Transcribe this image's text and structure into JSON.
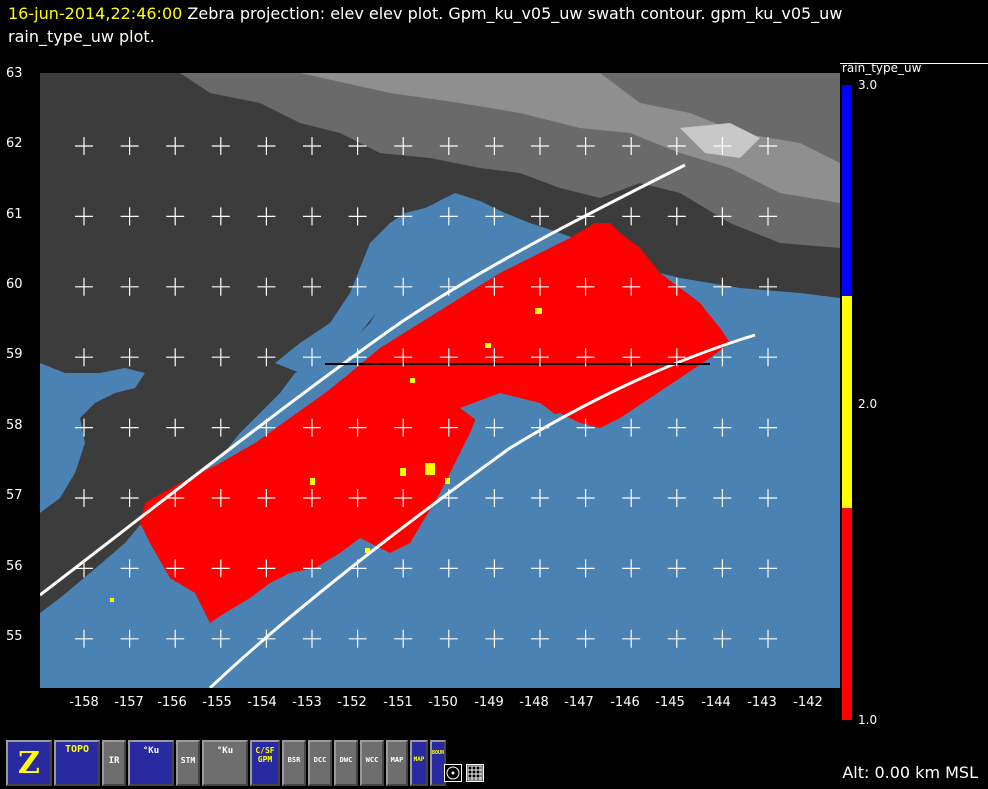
{
  "title": {
    "timestamp": "16-jun-2014,22:46:00",
    "line1_rest": "  Zebra projection: elev elev  plot.  Gpm_ku_v05_uw swath contour.  gpm_ku_v05_uw",
    "line2": "rain_type_uw  plot."
  },
  "map": {
    "lat_labels": [
      "63",
      "62",
      "61",
      "60",
      "59",
      "58",
      "57",
      "56",
      "55"
    ],
    "lon_labels": [
      "-158",
      "-157",
      "-156",
      "-155",
      "-154",
      "-153",
      "-152",
      "-151",
      "-150",
      "-149",
      "-148",
      "-147",
      "-146",
      "-145",
      "-144",
      "-143",
      "-142"
    ],
    "colors": {
      "ocean": "#4a82b4",
      "land_dark": "#3c3c3c",
      "rain_stratiform": "#ff0000",
      "rain_convective": "#ffff00",
      "swath_edge": "#ffffff"
    }
  },
  "colorbar": {
    "label": "rain_type_uw",
    "ticks": [
      "3.0",
      "2.0",
      "1.0"
    ],
    "colors": [
      "#0000ff",
      "#ffff00",
      "#ff0000"
    ]
  },
  "toolbar": {
    "buttons": [
      {
        "name": "zebra-logo-button",
        "label": "Z"
      },
      {
        "name": "topo-button",
        "label": "TOPO"
      },
      {
        "name": "ir-button",
        "label": "IR"
      },
      {
        "name": "ku-button",
        "label": "°Ku"
      },
      {
        "name": "stm-button",
        "label": "STM"
      },
      {
        "name": "ku-ws-button",
        "label": "°Ku"
      },
      {
        "name": "c-sf-gpm-button",
        "label": "C/SF GPM"
      },
      {
        "name": "bsr-button",
        "label": "BSR"
      },
      {
        "name": "dcc-button",
        "label": "DCC"
      },
      {
        "name": "dwc-button",
        "label": "DWC"
      },
      {
        "name": "wcc-button",
        "label": "WCC"
      },
      {
        "name": "map-button",
        "label": "MAP"
      },
      {
        "name": "map-us-button",
        "label": "MAP"
      },
      {
        "name": "bounds-button",
        "label": "BOUNDS"
      }
    ]
  },
  "status": {
    "altitude": "Alt: 0.00 km MSL"
  }
}
